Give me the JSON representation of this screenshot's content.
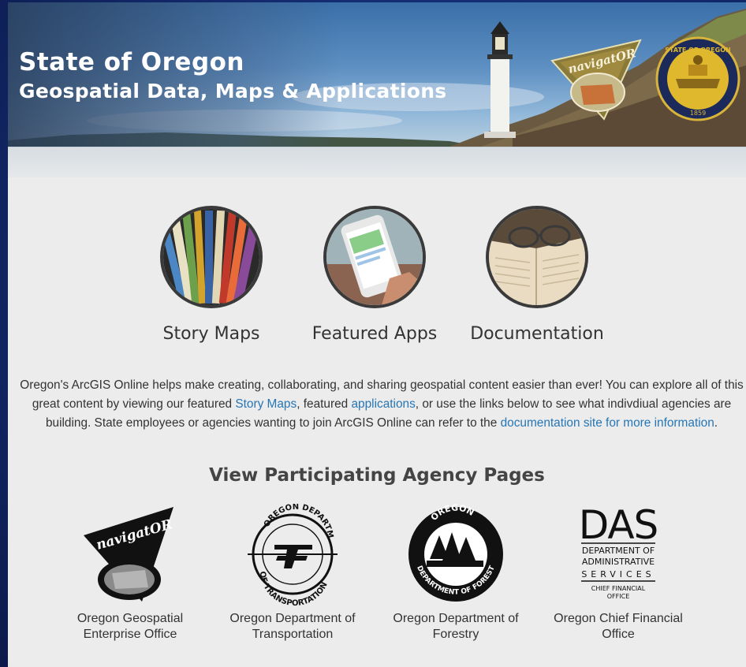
{
  "banner": {
    "title": "State of Oregon",
    "subtitle": "Geospatial Data, Maps & Applications",
    "navigator_logo_text": "navigatOR",
    "seal_text": "STATE OF OREGON",
    "seal_year": "1859"
  },
  "features": [
    {
      "label": "Story Maps",
      "icon": "books-icon"
    },
    {
      "label": "Featured Apps",
      "icon": "phone-app-icon"
    },
    {
      "label": "Documentation",
      "icon": "open-book-glasses-icon"
    }
  ],
  "intro": {
    "part1": "Oregon's ArcGIS Online helps make creating, collaborating, and sharing geospatial content easier than ever! You can explore all of this great content by viewing our featured ",
    "link_story_maps": "Story Maps",
    "part2": ", featured ",
    "link_applications": "applications",
    "part3": ", or use the links below to see what indivdiual agencies are building. State employees or agencies wanting to join ArcGIS Online can refer to the ",
    "link_documentation": "documentation site for more information",
    "part4": "."
  },
  "agency_section": {
    "heading": "View Participating Agency Pages",
    "agencies": [
      {
        "label": "Oregon Geospatial Enterprise Office",
        "logo_text": "navigatOR"
      },
      {
        "label": "Oregon Department of Transportation",
        "logo_top": "OREGON DEPARTMENT",
        "logo_bottom": "OF TRANSPORTATION"
      },
      {
        "label": "Oregon Department of Forestry",
        "logo_top": "OREGON",
        "logo_bottom": "DEPARTMENT OF FORESTRY"
      },
      {
        "label": "Oregon Chief Financial Office",
        "logo_big": "DAS",
        "logo_line1": "DEPARTMENT OF",
        "logo_line2": "ADMINISTRATIVE",
        "logo_line3": "SERVICES",
        "logo_line4": "CHIEF FINANCIAL",
        "logo_line5": "OFFICE"
      }
    ]
  },
  "colors": {
    "link": "#2676b5",
    "page_background": "#ececec",
    "outer_background": "#132a6e"
  }
}
